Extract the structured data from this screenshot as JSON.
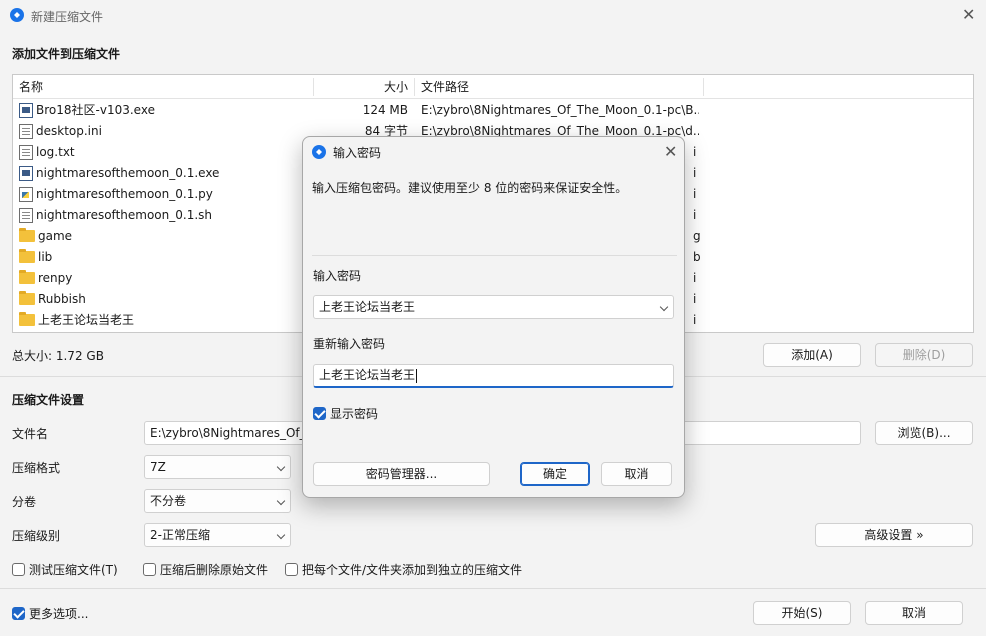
{
  "window": {
    "title": "新建压缩文件"
  },
  "section_add": "添加文件到压缩文件",
  "file_list": {
    "columns": [
      "名称",
      "大小",
      "文件路径"
    ],
    "rows": [
      {
        "icon": "exe",
        "name": "Bro18社区-v103.exe",
        "size": "124 MB",
        "path": "E:\\zybro\\8Nightmares_Of_The_Moon_0.1-pc\\B..."
      },
      {
        "icon": "ini",
        "name": "desktop.ini",
        "size": "84 字节",
        "path": "E:\\zybro\\8Nightmares_Of_The_Moon_0.1-pc\\d..."
      },
      {
        "icon": "txt",
        "name": "log.txt",
        "size": "",
        "path": ""
      },
      {
        "icon": "exe",
        "name": "nightmaresofthemoon_0.1.exe",
        "size": "",
        "path": ""
      },
      {
        "icon": "py",
        "name": "nightmaresofthemoon_0.1.py",
        "size": "",
        "path": ""
      },
      {
        "icon": "sh",
        "name": "nightmaresofthemoon_0.1.sh",
        "size": "",
        "path": ""
      },
      {
        "icon": "folder",
        "name": "game",
        "size": "",
        "path": ""
      },
      {
        "icon": "folder",
        "name": "lib",
        "size": "",
        "path": ""
      },
      {
        "icon": "folder",
        "name": "renpy",
        "size": "",
        "path": ""
      },
      {
        "icon": "folder",
        "name": "Rubbish",
        "size": "",
        "path": ""
      },
      {
        "icon": "folder",
        "name": "上老王论坛当老王",
        "size": "",
        "path": ""
      }
    ],
    "partial_path_tails": [
      "i",
      "i",
      "i",
      "i",
      "g",
      "b",
      "i",
      "i",
      "i"
    ]
  },
  "total_size": "总大小: 1.72 GB",
  "buttons": {
    "add": "添加(A)",
    "delete": "删除(D)",
    "browse": "浏览(B)...",
    "advanced": "高级设置 »",
    "start": "开始(S)",
    "cancel": "取消"
  },
  "section_settings": "压缩文件设置",
  "settings": {
    "filename_label": "文件名",
    "filename_value": "E:\\zybro\\8Nightmares_Of_T",
    "format_label": "压缩格式",
    "format_value": "7Z",
    "volume_label": "分卷",
    "volume_value": "不分卷",
    "level_label": "压缩级别",
    "level_value": "2-正常压缩"
  },
  "options": {
    "test": "测试压缩文件(T)",
    "delete_after": "压缩后删除原始文件",
    "separate": "把每个文件/文件夹添加到独立的压缩文件",
    "more": "更多选项..."
  },
  "dialog": {
    "title": "输入密码",
    "description": "输入压缩包密码。建议使用至少 8 位的密码来保证安全性。",
    "password_label": "输入密码",
    "password_value": "上老王论坛当老王",
    "confirm_label": "重新输入密码",
    "confirm_value": "上老王论坛当老王",
    "show_password": "显示密码",
    "manager_button": "密码管理器...",
    "ok_button": "确定",
    "cancel_button": "取消"
  },
  "colors": {
    "accent": "#1e66c8",
    "folder": "#f3c13b"
  }
}
